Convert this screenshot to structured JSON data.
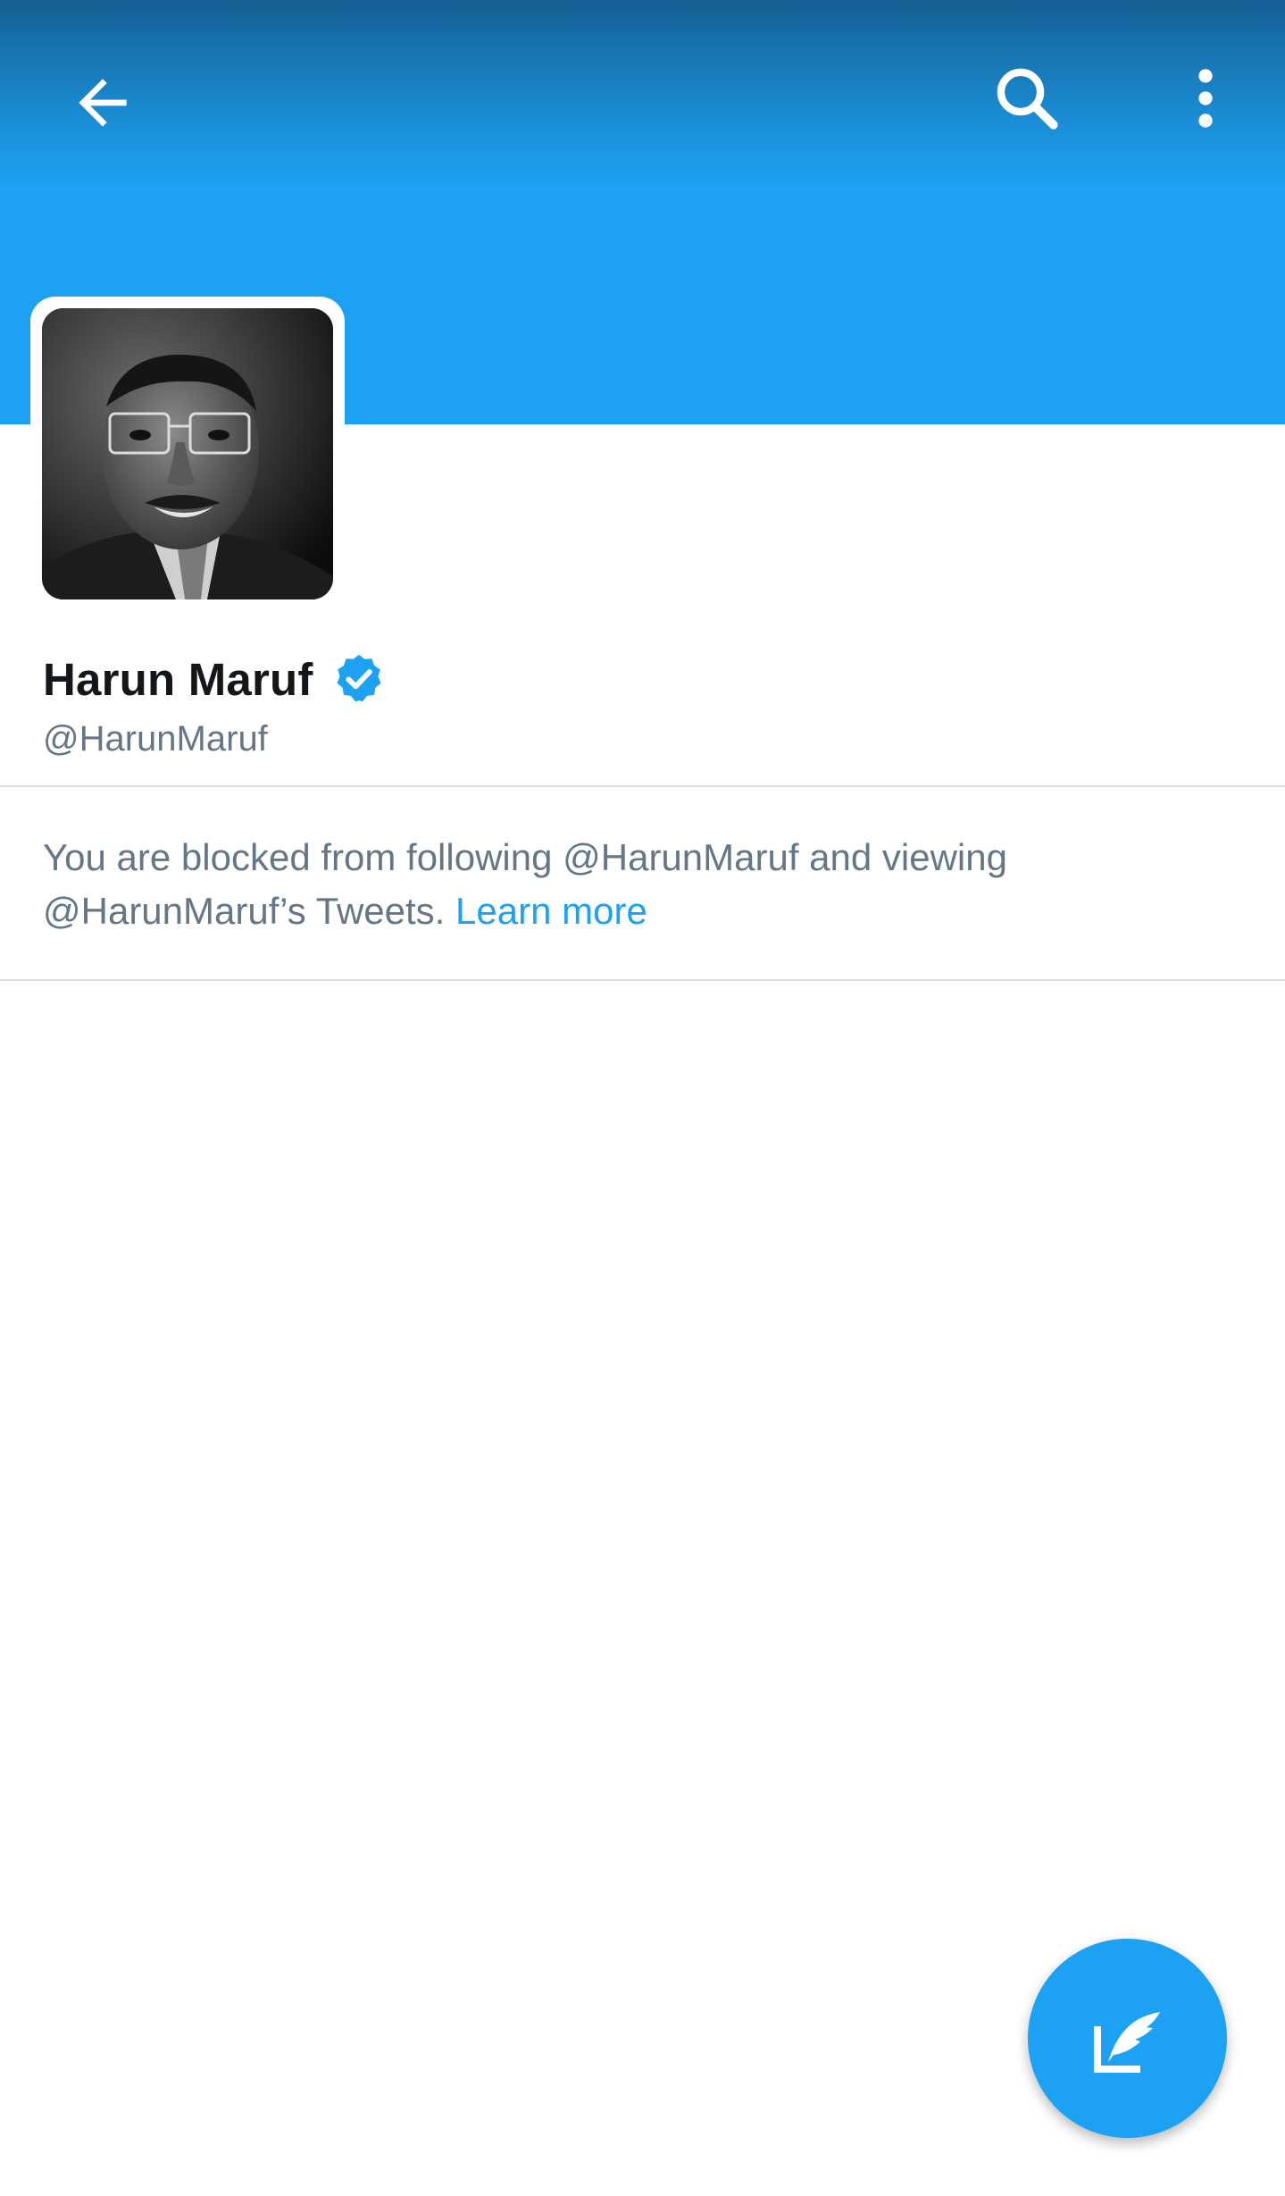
{
  "colors": {
    "brand_blue": "#1da1f2",
    "header_dark": "#155f93",
    "text_primary": "#14171a",
    "text_secondary": "#657786",
    "divider": "#dadfe3"
  },
  "header": {
    "back_icon": "back-arrow-icon",
    "search_icon": "search-icon",
    "more_icon": "more-vertical-icon"
  },
  "profile": {
    "display_name": "Harun Maruf",
    "verified_icon": "verified-badge-icon",
    "handle": "@HarunMaruf"
  },
  "blocked_notice": {
    "message": "You are blocked from following @HarunMaruf and viewing @HarunMaruf’s Tweets.",
    "link_label": "Learn more"
  },
  "fab": {
    "icon": "compose-tweet-icon"
  }
}
